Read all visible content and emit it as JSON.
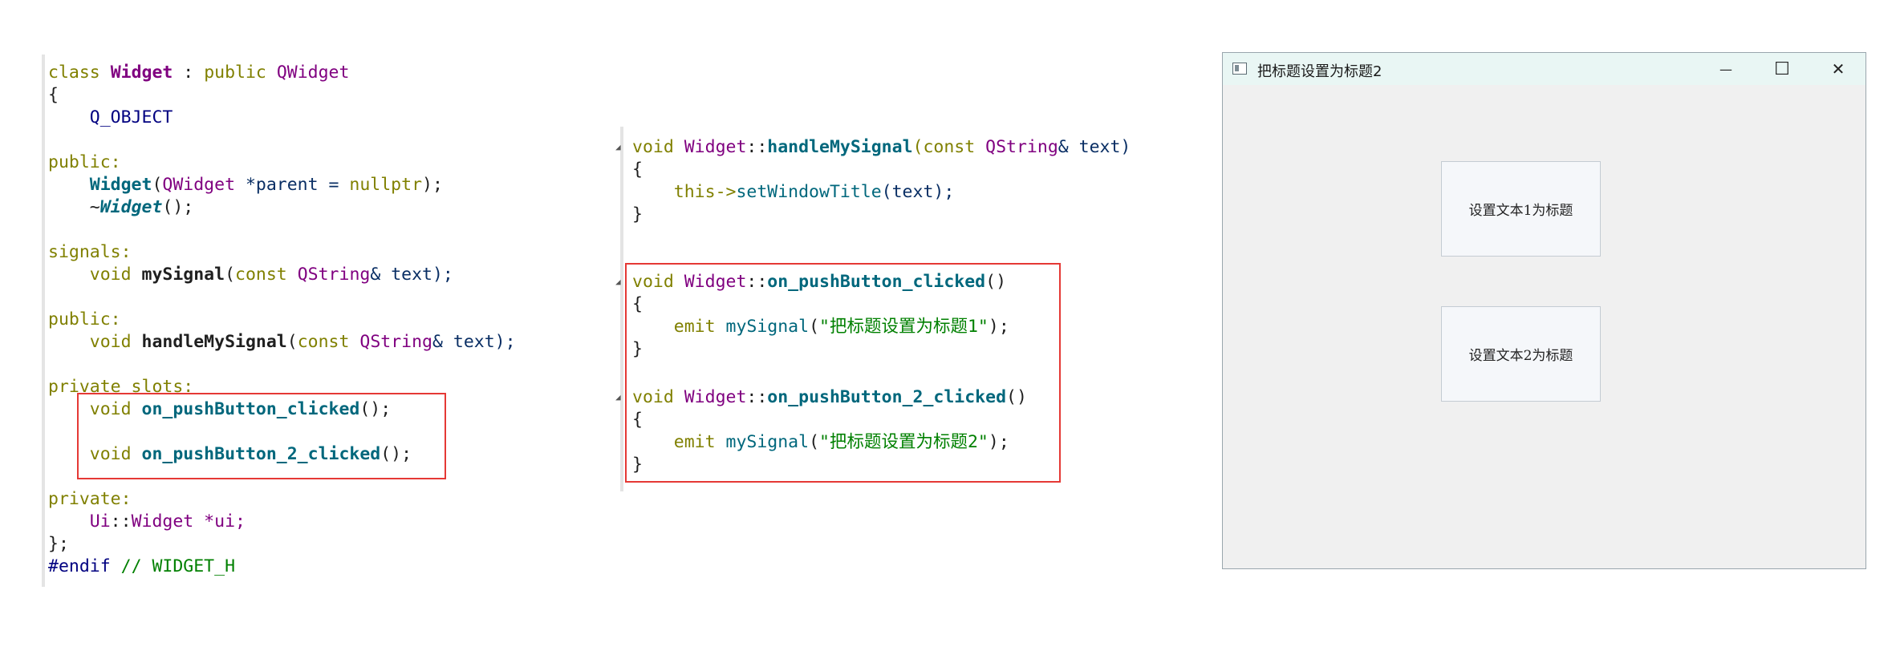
{
  "header_code": {
    "class_kw": "class",
    "class_name": "Widget",
    "colon": " : ",
    "public_kw": "public",
    "base": "QWidget",
    "open_brace": "{",
    "q_object": "Q_OBJECT",
    "public_label_1": "public:",
    "ctor_name": "Widget",
    "ctor_arg_type": "QWidget",
    "ctor_arg_rest": " *parent = ",
    "nullptr": "nullptr",
    "ctor_end": ");",
    "dtor_tilde": "~",
    "dtor_name": "Widget",
    "dtor_end": "();",
    "signals_label": "signals:",
    "void_1": "void",
    "my_signal": "mySignal",
    "const_1": "const",
    "qstring_1": "QString",
    "sig_rest": "& text);",
    "public_label_2": "public:",
    "void_2": "void",
    "handle_name": "handleMySignal",
    "const_2": "const",
    "qstring_2": "QString",
    "handle_rest": "& text);",
    "private_slots_label": "private slots:",
    "void_3": "void",
    "slot1_name": "on_pushButton_clicked",
    "slot1_end": "();",
    "void_4": "void",
    "slot2_name": "on_pushButton_2_clicked",
    "slot2_end": "();",
    "private_label": "private:",
    "ui_ns": "Ui",
    "ui_sep": "::",
    "ui_type": "Widget",
    "ui_rest": " *ui;",
    "close_brace": "};",
    "endif": "#endif",
    "endif_comment": "// WIDGET_H"
  },
  "impl_code": {
    "void_1": "void",
    "cls_1": "Widget",
    "sep_1": "::",
    "handle_name": "handleMySignal",
    "paren_open_1": "(",
    "const_1": "const",
    "qstring_1": "QString",
    "handle_rest": "& text)",
    "brace_1": "{",
    "this_kw": "this",
    "arrow": "->",
    "set_title": "setWindowTitle",
    "set_title_rest": "(text);",
    "brace_close_1": "}",
    "void_2": "void",
    "cls_2": "Widget",
    "sep_2": "::",
    "slot1_name": "on_pushButton_clicked",
    "slot1_paren": "()",
    "brace_2": "{",
    "emit_1": "emit",
    "emit_sig_1": "mySignal",
    "emit_open_1": "(",
    "emit_str_1": "\"把标题设置为标题1\"",
    "emit_close_1": ");",
    "brace_close_2": "}",
    "void_3": "void",
    "cls_3": "Widget",
    "sep_3": "::",
    "slot2_name": "on_pushButton_2_clicked",
    "slot2_paren": "()",
    "brace_3": "{",
    "emit_2": "emit",
    "emit_sig_2": "mySignal",
    "emit_open_2": "(",
    "emit_str_2": "\"把标题设置为标题2\"",
    "emit_close_2": ");",
    "brace_close_3": "}"
  },
  "window": {
    "title": "把标题设置为标题2",
    "minimize_glyph": "—",
    "maximize_glyph": "☐",
    "close_glyph": "✕",
    "button1_label": "设置文本1为标题",
    "button2_label": "设置文本2为标题"
  },
  "colors": {
    "keyword": "#808000",
    "class": "#800080",
    "function": "#00677c",
    "string": "#008000",
    "highlight_box": "#e53935",
    "titlebar": "#e9f6f4"
  },
  "icons": [
    "app-window-icon",
    "minimize-icon",
    "maximize-icon",
    "close-icon",
    "fold-arrow-icon"
  ]
}
